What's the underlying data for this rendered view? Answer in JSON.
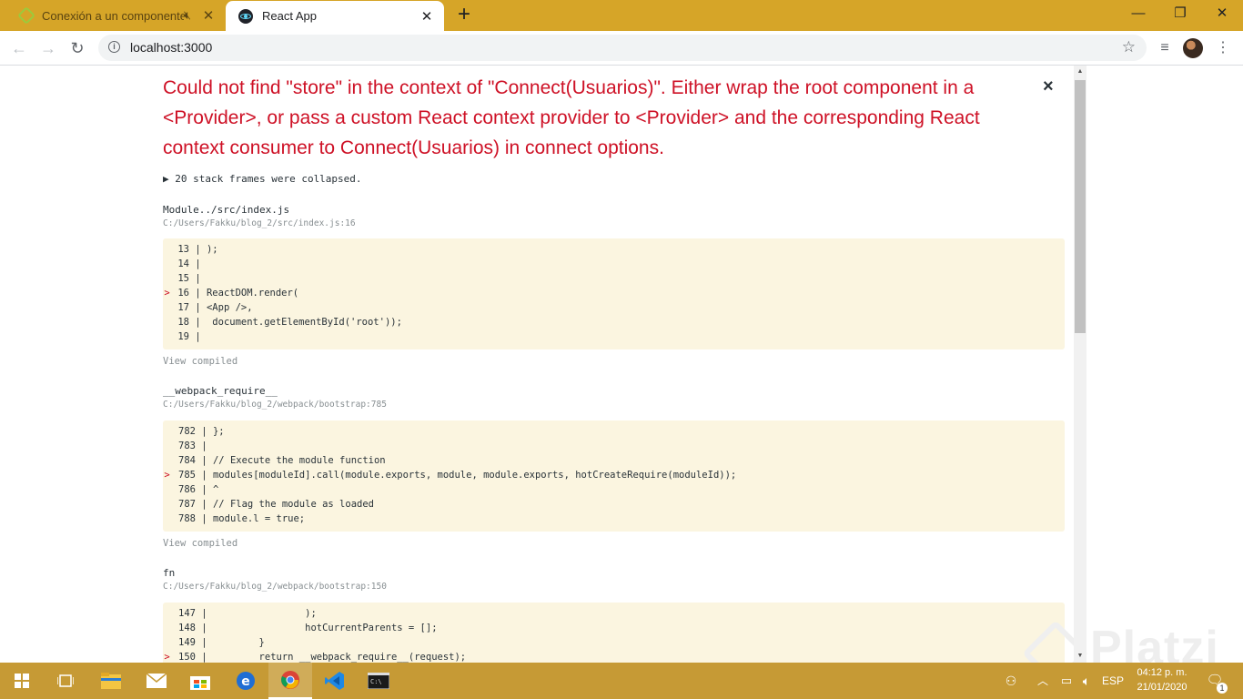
{
  "tabs": [
    {
      "title": "Conexión a un componente",
      "active": false
    },
    {
      "title": "React App",
      "active": true
    }
  ],
  "window_controls": {
    "minimize": "—",
    "restore": "❐",
    "close": "✕"
  },
  "toolbar": {
    "url": "localhost:3000"
  },
  "error": {
    "message": "Could not find \"store\" in the context of \"Connect(Usuarios)\". Either wrap the root component in a <Provider>, or pass a custom React context provider to <Provider> and the corresponding React context consumer to Connect(Usuarios) in connect options.",
    "close": "×",
    "collapsed": "▶ 20 stack frames were collapsed."
  },
  "frames": [
    {
      "name": "Module../src/index.js",
      "path": "C:/Users/Fakku/blog_2/src/index.js:16",
      "view_compiled": "View compiled",
      "lines": [
        {
          "n": "13",
          "code": " );",
          "hl": false
        },
        {
          "n": "14",
          "code": "",
          "hl": false
        },
        {
          "n": "15",
          "code": "",
          "hl": false
        },
        {
          "n": "16",
          "code": " ReactDOM.render(",
          "hl": true
        },
        {
          "n": "17",
          "code": " <App />,",
          "hl": false
        },
        {
          "n": "18",
          "code": "  document.getElementById('root'));",
          "hl": false
        },
        {
          "n": "19",
          "code": "",
          "hl": false
        }
      ]
    },
    {
      "name": "__webpack_require__",
      "path": "C:/Users/Fakku/blog_2/webpack/bootstrap:785",
      "view_compiled": "View compiled",
      "lines": [
        {
          "n": "782",
          "code": " };",
          "hl": false
        },
        {
          "n": "783",
          "code": "",
          "hl": false
        },
        {
          "n": "784",
          "code": " // Execute the module function",
          "hl": false
        },
        {
          "n": "785",
          "code": " modules[moduleId].call(module.exports, module, module.exports, hotCreateRequire(moduleId));",
          "hl": true
        },
        {
          "n": "786",
          "code": " ^",
          "hl": false
        },
        {
          "n": "787",
          "code": " // Flag the module as loaded",
          "hl": false
        },
        {
          "n": "788",
          "code": " module.l = true;",
          "hl": false
        }
      ]
    },
    {
      "name": "fn",
      "path": "C:/Users/Fakku/blog_2/webpack/bootstrap:150",
      "view_compiled": "",
      "lines": [
        {
          "n": "147",
          "code": "                 );",
          "hl": false
        },
        {
          "n": "148",
          "code": "                 hotCurrentParents = [];",
          "hl": false
        },
        {
          "n": "149",
          "code": "         }",
          "hl": false
        },
        {
          "n": "150",
          "code": "         return __webpack_require__(request);",
          "hl": true
        }
      ]
    }
  ],
  "watermark": "Platzi",
  "taskbar": {
    "apps": [
      "windows-start-icon",
      "task-view-icon",
      "file-explorer-icon",
      "mail-icon",
      "store-icon",
      "edge-icon",
      "chrome-icon",
      "vscode-icon",
      "terminal-icon"
    ],
    "language": "ESP",
    "time": "04:12 p. m.",
    "date": "21/01/2020",
    "notifications": "1"
  },
  "colors": {
    "titlebar": "#d6a528",
    "error": "#ce1126",
    "code_bg": "#fbf5e0",
    "taskbar": "#c69a35"
  }
}
